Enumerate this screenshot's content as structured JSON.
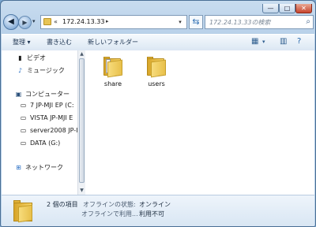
{
  "window": {
    "minimize_glyph": "—",
    "maximize_glyph": "□",
    "close_glyph": "✕"
  },
  "nav": {
    "back_glyph": "◀",
    "forward_glyph": "▶",
    "recent_glyph": "▾"
  },
  "address": {
    "prefix": "«",
    "path": "172.24.13.33",
    "separator": "▸",
    "dropdown": "▾"
  },
  "refresh_glyph": "⇆",
  "search": {
    "placeholder": "172.24.13.33の検索",
    "icon": "search-icon"
  },
  "toolbar": {
    "organize": "整理 ▾",
    "burn": "書き込む",
    "new_folder": "新しいフォルダー",
    "view_icon": "view-icon",
    "preview_icon": "preview-pane-icon",
    "help_icon": "help-icon"
  },
  "sidebar": {
    "items": [
      {
        "label": "ビデオ",
        "icon": "video-icon"
      },
      {
        "label": "ミュージック",
        "icon": "music-icon"
      },
      {
        "label": "コンピューター",
        "icon": "computer-icon"
      },
      {
        "label": "7 JP-MJI EP (C:",
        "icon": "drive-icon"
      },
      {
        "label": "VISTA JP-MJI E",
        "icon": "drive-icon"
      },
      {
        "label": "server2008 JP-I",
        "icon": "drive-icon"
      },
      {
        "label": "DATA (G:)",
        "icon": "drive-icon"
      },
      {
        "label": "ネットワーク",
        "icon": "network-icon"
      }
    ]
  },
  "files": [
    {
      "name": "share",
      "type": "shared-folder"
    },
    {
      "name": "users",
      "type": "folder"
    }
  ],
  "details": {
    "count": "2 個の項目",
    "offline_status_label": "オフラインの状態:",
    "offline_status_value": "オンライン",
    "offline_usage_label": "オフラインで利用...",
    "offline_usage_value": "利用不可"
  },
  "colors": {
    "folder": "#e8c04b",
    "titlebar": "#b9d2ea",
    "close_button": "#c7452d"
  }
}
